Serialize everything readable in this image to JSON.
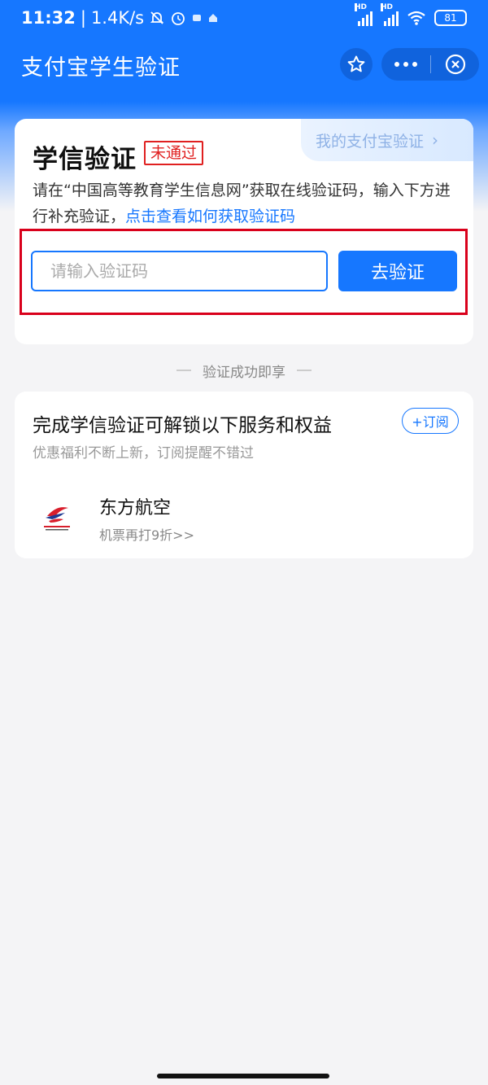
{
  "status_bar": {
    "time": "11:32",
    "speed": "1.4K/s",
    "battery": "81",
    "hd": "HD"
  },
  "header": {
    "title": "支付宝学生验证"
  },
  "verify_card": {
    "title": "学信验证",
    "status_badge": "未通过",
    "my_verify_link": "我的支付宝验证",
    "description": "请在“中国高等教育学生信息网”获取在线验证码，输入下方进行补充验证，",
    "help_link": "点击查看如何获取验证码",
    "input_placeholder": "请输入验证码",
    "input_value": "",
    "submit_label": "去验证"
  },
  "divider_text": "验证成功即享",
  "benefits_card": {
    "title": "完成学信验证可解锁以下服务和权益",
    "subscribe_label": "+订阅",
    "subtitle": "优惠福利不断上新，订阅提醒不错过",
    "items": [
      {
        "name": "东方航空",
        "desc": "机票再打9折>>",
        "icon": "china-eastern-logo"
      }
    ]
  },
  "colors": {
    "primary": "#1677ff",
    "badge_red": "#e02020",
    "highlight_red": "#d9001b"
  }
}
